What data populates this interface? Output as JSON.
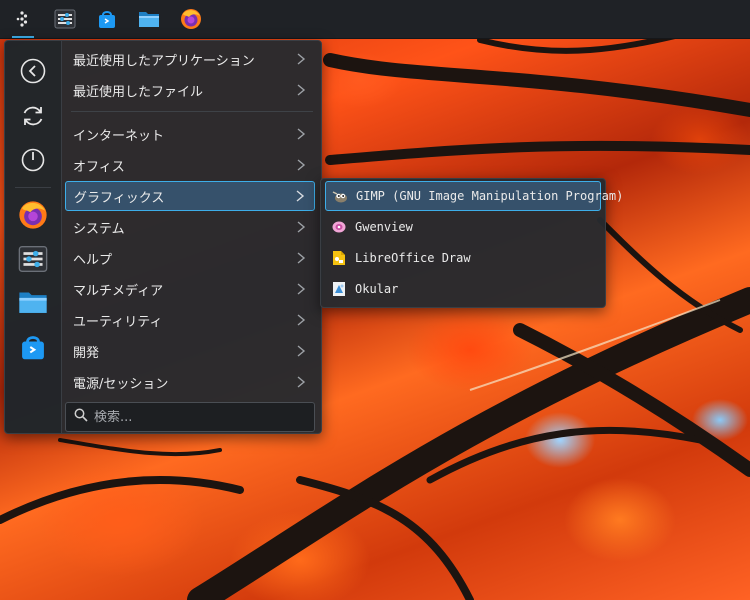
{
  "taskbar": {
    "items": [
      {
        "icon": "application-launcher-icon",
        "active": true
      },
      {
        "icon": "system-settings-icon"
      },
      {
        "icon": "discover-store-icon"
      },
      {
        "icon": "file-manager-icon"
      },
      {
        "icon": "firefox-icon"
      }
    ]
  },
  "launcher": {
    "sidebar": [
      {
        "icon": "back-icon"
      },
      {
        "icon": "restart-icon"
      },
      {
        "icon": "power-icon"
      },
      {
        "icon": "firefox-icon"
      },
      {
        "icon": "system-settings-icon"
      },
      {
        "icon": "file-manager-icon"
      },
      {
        "icon": "discover-store-icon"
      }
    ],
    "menu": {
      "recent_apps": "最近使用したアプリケーション",
      "recent_files": "最近使用したファイル",
      "internet": "インターネット",
      "office": "オフィス",
      "graphics": "グラフィックス",
      "system": "システム",
      "help": "ヘルプ",
      "multimedia": "マルチメディア",
      "utilities": "ユーティリティ",
      "development": "開発",
      "power_session": "電源/セッション"
    },
    "search": {
      "placeholder": "検索..."
    }
  },
  "submenu": {
    "items": [
      {
        "label": "GIMP (GNU Image Manipulation Program)",
        "icon": "gimp-icon"
      },
      {
        "label": "Gwenview",
        "icon": "gwenview-icon"
      },
      {
        "label": "LibreOffice Draw",
        "icon": "libreoffice-draw-icon"
      },
      {
        "label": "Okular",
        "icon": "okular-icon"
      }
    ]
  },
  "colors": {
    "accent": "#3daee9",
    "panel": "#272a2e",
    "selection": "#36516b"
  }
}
